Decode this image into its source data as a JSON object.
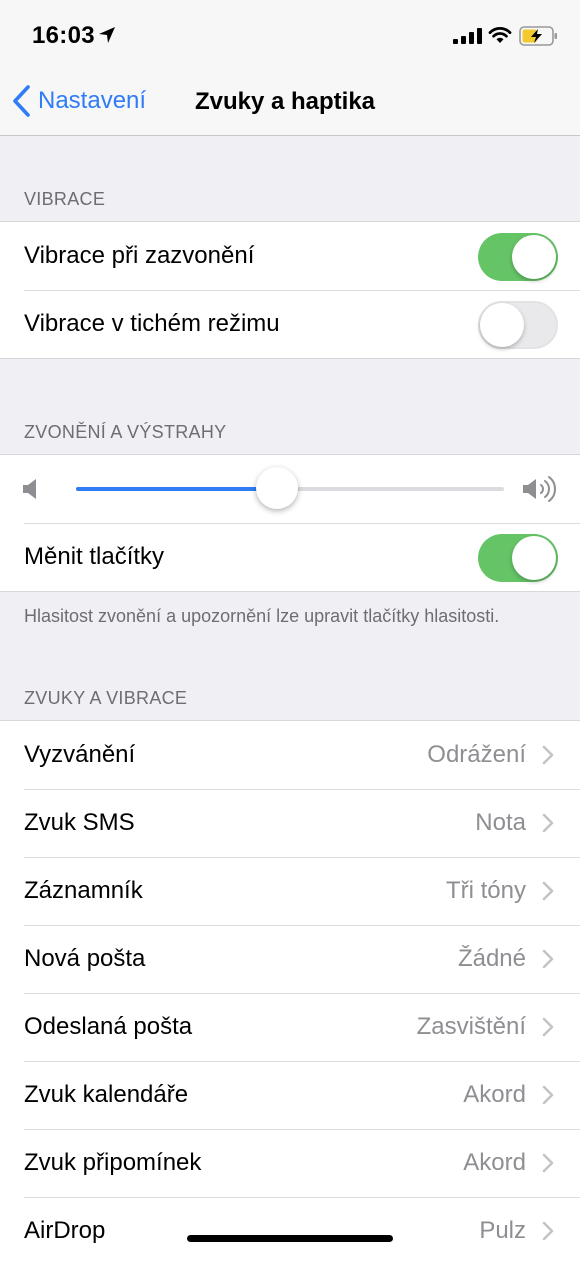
{
  "status": {
    "time": "16:03"
  },
  "nav": {
    "back_label": "Nastavení",
    "title": "Zvuky a haptika"
  },
  "vibrace": {
    "header": "VIBRACE",
    "items": [
      {
        "label": "Vibrace při zazvonění",
        "on": true
      },
      {
        "label": "Vibrace v tichém režimu",
        "on": false
      }
    ]
  },
  "ringer": {
    "header": "ZVONĚNÍ A VÝSTRAHY",
    "volume_fraction": 0.47,
    "change_label": "Měnit tlačítky",
    "change_on": true,
    "footnote": "Hlasitost zvonění a upozornění lze upravit tlačítky hlasitosti."
  },
  "sounds": {
    "header": "ZVUKY A VIBRACE",
    "items": [
      {
        "label": "Vyzvánění",
        "value": "Odrážení"
      },
      {
        "label": "Zvuk SMS",
        "value": "Nota"
      },
      {
        "label": "Záznamník",
        "value": "Tři tóny"
      },
      {
        "label": "Nová pošta",
        "value": "Žádné"
      },
      {
        "label": "Odeslaná pošta",
        "value": "Zasvištění"
      },
      {
        "label": "Zvuk kalendáře",
        "value": "Akord"
      },
      {
        "label": "Zvuk připomínek",
        "value": "Akord"
      },
      {
        "label": "AirDrop",
        "value": "Pulz"
      }
    ]
  },
  "colors": {
    "accent": "#2f7cf6",
    "toggle_on": "#65c466"
  }
}
